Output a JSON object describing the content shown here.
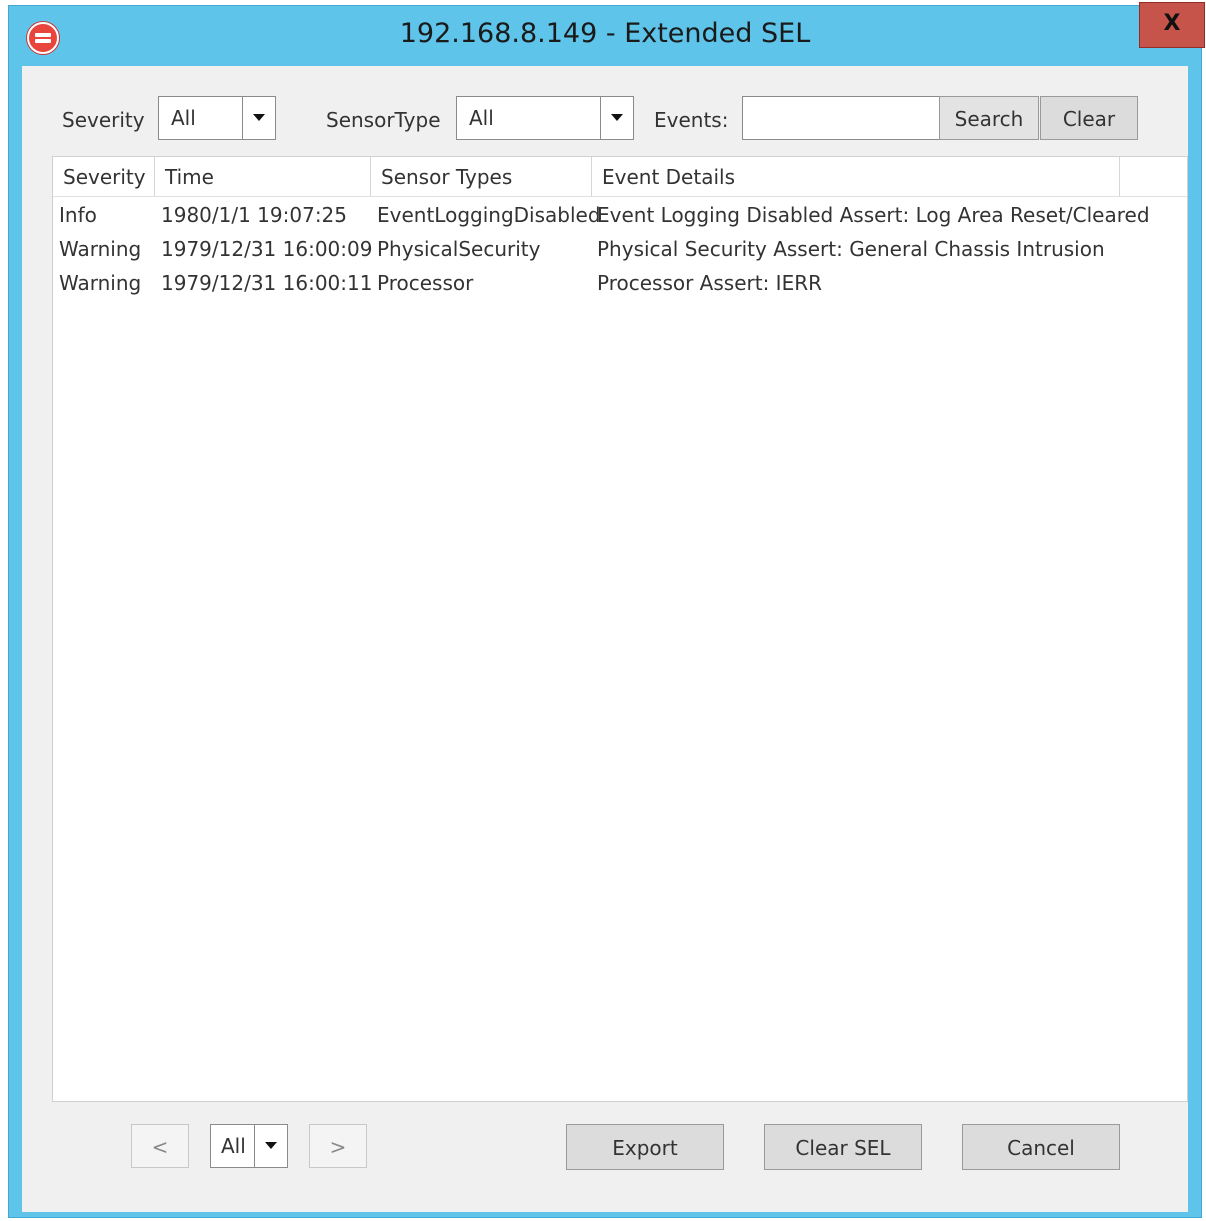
{
  "window": {
    "title": "192.168.8.149 - Extended SEL",
    "close_label": "X"
  },
  "filters": {
    "severity_label": "Severity",
    "severity_value": "All",
    "sensortype_label": "SensorType",
    "sensortype_value": "All",
    "events_label": "Events:",
    "events_value": "",
    "search_label": "Search",
    "clear_label": "Clear"
  },
  "table": {
    "columns": [
      "Severity",
      "Time",
      "Sensor Types",
      "Event Details"
    ],
    "rows": [
      {
        "severity": "Info",
        "time": "1980/1/1 19:07:25",
        "sensor": "EventLoggingDisabled",
        "details": "Event Logging Disabled Assert: Log Area Reset/Cleared"
      },
      {
        "severity": "Warning",
        "time": "1979/12/31 16:00:09",
        "sensor": "PhysicalSecurity",
        "details": "Physical Security Assert: General Chassis Intrusion"
      },
      {
        "severity": "Warning",
        "time": "1979/12/31 16:00:11",
        "sensor": "Processor",
        "details": "Processor Assert: IERR"
      }
    ]
  },
  "pager": {
    "prev_label": "<",
    "page_value": "All",
    "next_label": ">"
  },
  "actions": {
    "export_label": "Export",
    "clear_sel_label": "Clear SEL",
    "cancel_label": "Cancel"
  },
  "colors": {
    "title_bar": "#5ec4ea",
    "close_button": "#c7544b",
    "client_bg": "#f0f0f0"
  },
  "icons": {
    "app": "app-logo-icon",
    "close": "close-icon",
    "dropdown": "chevron-down-icon"
  }
}
